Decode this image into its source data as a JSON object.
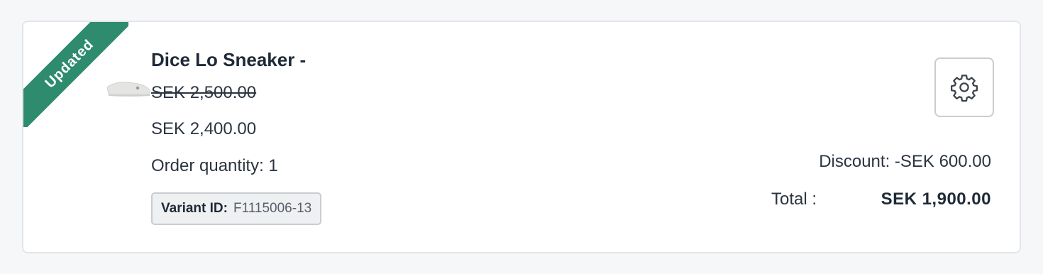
{
  "product": {
    "badge": "Updated",
    "title": "Dice Lo Sneaker -",
    "original_price": "SEK 2,500.00",
    "price": "SEK 2,400.00",
    "quantity_text": "Order quantity: 1",
    "variant_label": "Variant ID:",
    "variant_value": "F1115006-13"
  },
  "summary": {
    "discount_text": "Discount: -SEK 600.00",
    "total_label": "Total :",
    "total_value": "SEK 1,900.00"
  },
  "icons": {
    "settings": "gear-icon"
  },
  "colors": {
    "badge": "#2e8b6e",
    "card_border": "#e3e5e9",
    "text": "#1f2a37"
  }
}
